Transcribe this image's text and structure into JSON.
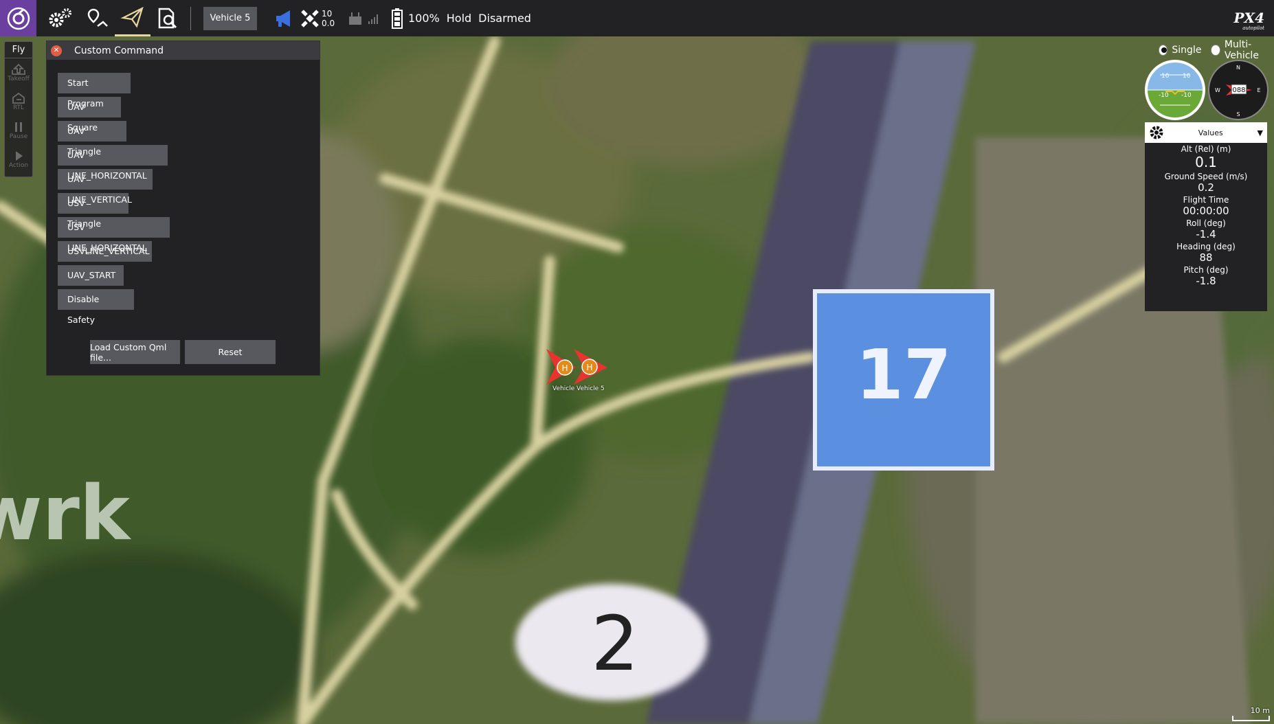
{
  "toolbar": {
    "vehicle_selector": "Vehicle 5",
    "satellite_count": "10",
    "hdop": "0.0",
    "battery": "100%",
    "flight_mode": "Hold",
    "arm_state": "Disarmed",
    "brand_logo": "PX4",
    "brand_sub": "autopilot",
    "icons": [
      "qgc-logo-icon",
      "settings-gears-icon",
      "plan-icon",
      "fly-paper-plane-icon",
      "analyze-icon",
      "messages-megaphone-icon",
      "gps-satellite-icon",
      "rc-icon",
      "signal-icon",
      "battery-icon"
    ]
  },
  "fly_toolbar": {
    "title": "Fly",
    "buttons": [
      {
        "label": "Takeoff",
        "icon": "takeoff-icon"
      },
      {
        "label": "RTL",
        "icon": "rtl-icon"
      },
      {
        "label": "Pause",
        "icon": "pause-icon"
      },
      {
        "label": "Action",
        "icon": "action-icon"
      }
    ]
  },
  "custom_command": {
    "title": "Custom Command",
    "commands": [
      "Start Program",
      "UAV Square",
      "UAV Triangle",
      "UAV LINE_HORIZONTAL",
      "UAV LINE_VERTICAL",
      "USV Triangle",
      "USV LINE_HORIZONTAL",
      "USVLINE_VERTICAL",
      "UAV_START",
      "Disable Safety"
    ],
    "load_button": "Load Custom Qml file...",
    "reset_button": "Reset"
  },
  "map": {
    "vehicle_labels": [
      "Vehicle",
      "Vehicle 5"
    ],
    "home_marker": "H",
    "road_sign_17": "17",
    "road_sign_2": "2",
    "place_text": "wrk",
    "scale_label": "10 m"
  },
  "view_mode": {
    "single": "Single",
    "multi": "Multi-Vehicle",
    "selected": "single"
  },
  "instruments": {
    "attitude_ticks": [
      "10",
      "10",
      "-10",
      "-10"
    ],
    "compass_n": "N",
    "compass_e": "E",
    "compass_s": "S",
    "compass_w": "W",
    "heading_readout": "088"
  },
  "values": {
    "header": "Values",
    "items": [
      {
        "label": "Alt (Rel) (m)",
        "value": "0.1"
      },
      {
        "label": "Ground Speed (m/s)",
        "value": "0.2"
      },
      {
        "label": "Flight Time",
        "value": "00:00:00"
      },
      {
        "label": "Roll (deg)",
        "value": "-1.4"
      },
      {
        "label": "Heading (deg)",
        "value": "88"
      },
      {
        "label": "Pitch (deg)",
        "value": "-1.8"
      }
    ]
  },
  "colors": {
    "toolbar": "#222224",
    "accent_purple": "#6a3fa0",
    "button": "#58585f",
    "close": "#e15e46",
    "sign_blue": "#5b8fe0",
    "vehicle_red": "#e8332e",
    "home_orange": "#e28a1a"
  }
}
